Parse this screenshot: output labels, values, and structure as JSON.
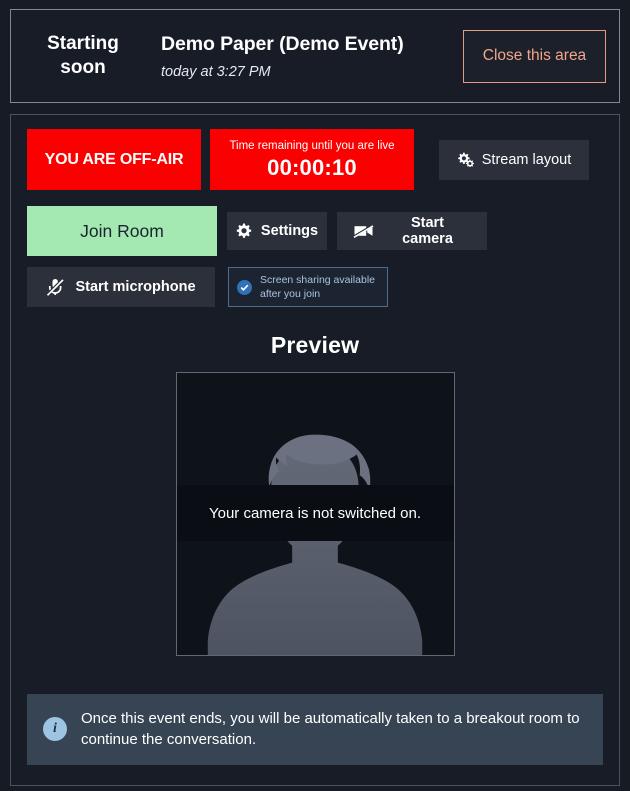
{
  "header": {
    "status_label": "Starting soon",
    "event_title": "Demo Paper (Demo Event)",
    "event_time": "today at 3:27 PM",
    "close_label": "Close this area"
  },
  "status": {
    "offair_label": "YOU ARE OFF-AIR",
    "timer_label": "Time remaining until you are live",
    "timer_value": "00:00:10",
    "stream_layout_label": "Stream layout",
    "offair_color": "#fa0000"
  },
  "controls": {
    "join_room_label": "Join Room",
    "join_room_color": "#a4e8b2",
    "settings_label": "Settings",
    "camera_label": "Start camera",
    "microphone_label": "Start microphone",
    "screenshare_note_line1": "Screen sharing available",
    "screenshare_note_line2": "after you join"
  },
  "preview": {
    "title": "Preview",
    "camera_message": "Your camera is not switched on."
  },
  "info": {
    "icon_glyph": "i",
    "message": "Once this event ends, you will be automatically taken to a breakout room to continue the conversation.",
    "accent_color": "#9dc4e2"
  }
}
